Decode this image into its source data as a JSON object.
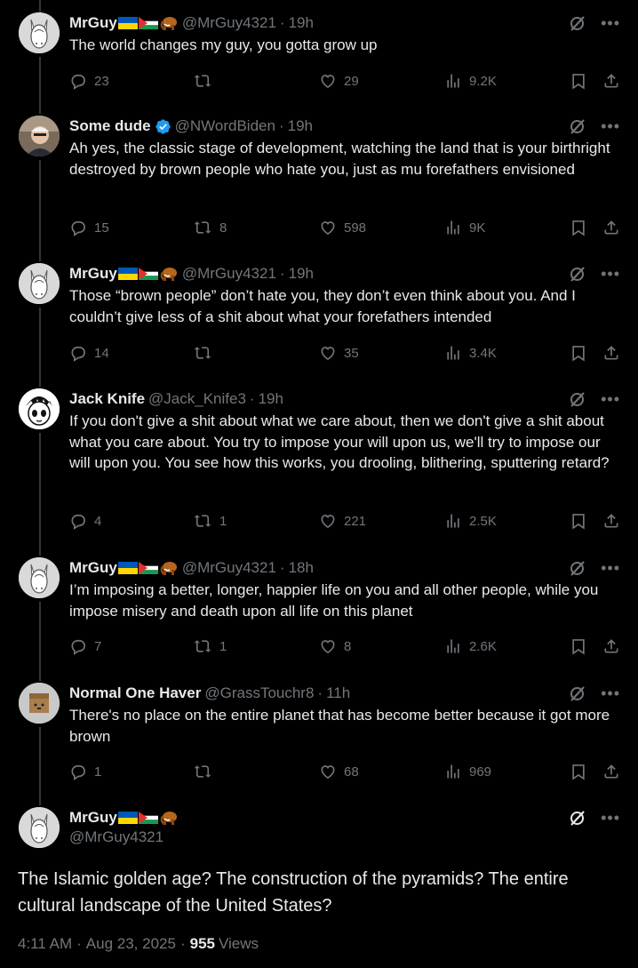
{
  "colors": {
    "background": "#000000",
    "text": "#e7e9ea",
    "muted": "#71767b",
    "line": "#333639",
    "verified": "#1d9bf0"
  },
  "replies": [
    {
      "name": "MrGuy",
      "badges": [
        "ukraine-flag",
        "palestine-flag",
        "mammoth-emoji"
      ],
      "handle": "@MrGuy4321",
      "sep": "·",
      "time": "19h",
      "text": "The world changes my guy, you gotta grow up",
      "replies": "23",
      "reposts": "",
      "likes": "29",
      "views": "9.2K",
      "avatar": "donkey"
    },
    {
      "name": "Some dude",
      "verified": true,
      "handle": "@NWordBiden",
      "sep": "·",
      "time": "19h",
      "text": "Ah yes, the classic stage of development, watching the land that is your birthright destroyed by brown people who hate you, just as mu forefathers envisioned",
      "replies": "15",
      "reposts": "8",
      "likes": "598",
      "views": "9K",
      "avatar": "photo"
    },
    {
      "name": "MrGuy",
      "badges": [
        "ukraine-flag",
        "palestine-flag",
        "mammoth-emoji"
      ],
      "handle": "@MrGuy4321",
      "sep": "·",
      "time": "19h",
      "text": "Those “brown people” don’t hate you, they don’t even think about you. And I couldn’t give less of a shit about what your forefathers intended",
      "replies": "14",
      "reposts": "",
      "likes": "35",
      "views": "3.4K",
      "avatar": "donkey"
    },
    {
      "name": "Jack Knife",
      "handle": "@Jack_Knife3",
      "sep": "·",
      "time": "19h",
      "text": "If you don't give a shit about what we care about, then we don't give a shit about what you care about. You try to impose your will upon us, we'll try to impose our will upon you. You see how this works, you drooling, blithering, sputtering retard?",
      "replies": "4",
      "reposts": "1",
      "likes": "221",
      "views": "2.5K",
      "avatar": "anime"
    },
    {
      "name": "MrGuy",
      "badges": [
        "ukraine-flag",
        "palestine-flag",
        "mammoth-emoji"
      ],
      "handle": "@MrGuy4321",
      "sep": "·",
      "time": "18h",
      "text": "I’m imposing a better, longer, happier life on you and all other people, while you impose misery and death upon all life on this planet",
      "replies": "7",
      "reposts": "1",
      "likes": "8",
      "views": "2.6K",
      "avatar": "donkey"
    },
    {
      "name": "Normal One Haver",
      "handle": "@GrassTouchr8",
      "sep": "·",
      "time": "11h",
      "text": "There's no place on the entire planet that has become better because it got more brown",
      "replies": "1",
      "reposts": "",
      "likes": "68",
      "views": "969",
      "avatar": "box"
    }
  ],
  "main": {
    "name": "MrGuy",
    "badges": [
      "ukraine-flag",
      "palestine-flag",
      "mammoth-emoji"
    ],
    "handle": "@MrGuy4321",
    "text": "The Islamic golden age? The construction of the pyramids? The entire cultural landscape of the United States?",
    "time": "4:11 AM",
    "sep1": "·",
    "date": "Aug 23, 2025",
    "sep2": "·",
    "views_count": "955",
    "views_label": "Views"
  },
  "icons": {
    "grok": "grok-icon",
    "more": "more-icon",
    "reply": "reply-icon",
    "repost": "repost-icon",
    "like": "heart-icon",
    "views": "views-icon",
    "bookmark": "bookmark-icon",
    "share": "share-icon"
  }
}
